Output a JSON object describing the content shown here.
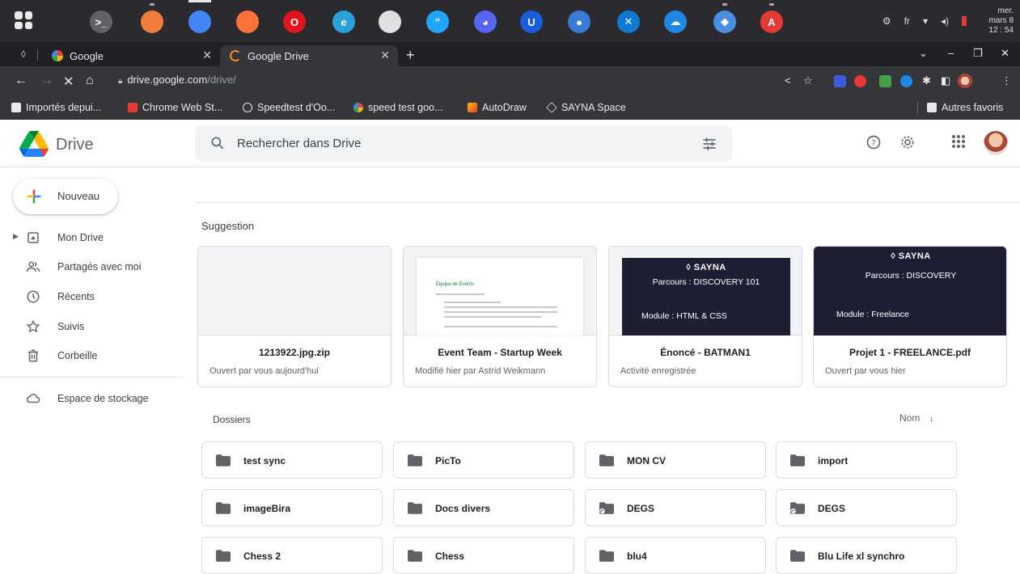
{
  "taskbar": {
    "apps": [
      {
        "name": "terminal-app-icon",
        "color": "#5f6368",
        "glyph": ">_"
      },
      {
        "name": "ubuntu-app-icon",
        "color": "#ef7d3b",
        "glyph": ""
      },
      {
        "name": "chrome-app-icon",
        "color": "#4285f4",
        "glyph": ""
      },
      {
        "name": "firefox-app-icon",
        "color": "#ff7139",
        "glyph": ""
      },
      {
        "name": "opera-app-icon",
        "color": "#e3141e",
        "glyph": "O"
      },
      {
        "name": "edge-app-icon",
        "color": "#2aa1d8",
        "glyph": "e"
      },
      {
        "name": "camera-app-icon",
        "color": "#e0e0e0",
        "glyph": ""
      },
      {
        "name": "chat-app-icon",
        "color": "#1ea7fd",
        "glyph": "\""
      },
      {
        "name": "discord-app-icon",
        "color": "#5865f2",
        "glyph": "◕"
      },
      {
        "name": "bitwarden-app-icon",
        "color": "#175ddc",
        "glyph": "U"
      },
      {
        "name": "toggle-app-icon",
        "color": "#3a7bd5",
        "glyph": "●"
      },
      {
        "name": "vscode-app-icon",
        "color": "#0e7ad2",
        "glyph": "✕"
      },
      {
        "name": "cloud-app-icon",
        "color": "#1e88e5",
        "glyph": "☁"
      },
      {
        "name": "files-app-icon",
        "color": "#4a90e2",
        "glyph": "◆"
      },
      {
        "name": "pdf-app-icon",
        "color": "#e53935",
        "glyph": "A"
      }
    ],
    "language": "fr",
    "clock": {
      "day": "mer.",
      "date": "mars 8",
      "time": "12 : 54"
    }
  },
  "tabs": [
    {
      "label": "Google",
      "favicon_color": "#4285f4"
    },
    {
      "label": "Google Drive",
      "favicon_color": "#f28b24"
    }
  ],
  "url": {
    "host": "drive.google.com",
    "path": "/drive/"
  },
  "bookmarks": [
    {
      "label": "Importés depui...",
      "icon": "folder-icon"
    },
    {
      "label": "Chrome Web St...",
      "icon": "webstore-icon"
    },
    {
      "label": "Speedtest d'Oo...",
      "icon": "speedtest-icon"
    },
    {
      "label": "speed test goo...",
      "icon": "google-icon"
    },
    {
      "label": "AutoDraw",
      "icon": "autodraw-icon"
    },
    {
      "label": "SAYNA Space",
      "icon": "sayna-icon"
    }
  ],
  "other_bookmarks": "Autres favoris",
  "drive": {
    "app_name": "Drive",
    "search_placeholder": "Rechercher dans Drive"
  },
  "sidebar": {
    "new_label": "Nouveau",
    "items": [
      {
        "label": "Mon Drive",
        "icon": "my-drive-icon"
      },
      {
        "label": "Partagés avec moi",
        "icon": "shared-icon"
      },
      {
        "label": "Récents",
        "icon": "clock-icon"
      },
      {
        "label": "Suivis",
        "icon": "star-icon"
      },
      {
        "label": "Corbeille",
        "icon": "trash-icon"
      }
    ],
    "storage_label": "Espace de stockage"
  },
  "main": {
    "suggestion_title": "Suggestion",
    "cards": [
      {
        "title": "1213922.jpg.zip",
        "subtitle": "Ouvert par vous aujourd'hui",
        "thumb": "blank"
      },
      {
        "title": "Event Team - Startup Week",
        "subtitle": "Modifié hier par Astrid Weikmann",
        "thumb": "doc",
        "doc_heading": "Equipe de Events"
      },
      {
        "title": "Énoncé - BATMAN1",
        "subtitle": "Activité enregistrée",
        "thumb": "slide",
        "brand": "◊ SAYNA",
        "parcours": "Parcours : DISCOVERY 101",
        "module": "Module : HTML & CSS"
      },
      {
        "title": "Projet 1 - FREELANCE.pdf",
        "subtitle": "Ouvert par vous hier",
        "thumb": "slide-full",
        "brand": "◊ SAYNA",
        "parcours": "Parcours : DISCOVERY",
        "module": "Module : Freelance"
      }
    ],
    "folders_title": "Dossiers",
    "sort_label": "Nom",
    "folders": [
      {
        "label": "test sync",
        "shared": false
      },
      {
        "label": "PicTo",
        "shared": false
      },
      {
        "label": "MON CV",
        "shared": false
      },
      {
        "label": "import",
        "shared": false
      },
      {
        "label": "imageBira",
        "shared": false
      },
      {
        "label": "Docs divers",
        "shared": false
      },
      {
        "label": "DEGS",
        "shared": true
      },
      {
        "label": "DEGS",
        "shared": true
      },
      {
        "label": "Chess 2",
        "shared": false
      },
      {
        "label": "Chess",
        "shared": false
      },
      {
        "label": "blu4",
        "shared": false
      },
      {
        "label": "Blu Life xl synchro",
        "shared": false
      }
    ]
  }
}
